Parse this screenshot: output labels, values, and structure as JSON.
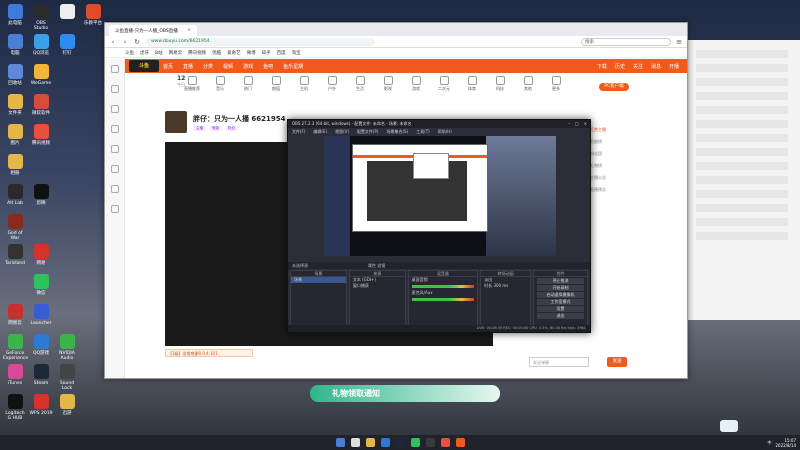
{
  "desktop": {
    "icons": [
      {
        "label": "此电脑",
        "col": 0,
        "row": 0,
        "color": "#3d7bd9"
      },
      {
        "label": "OBS Studio",
        "col": 1,
        "row": 0,
        "color": "#2b2b2b"
      },
      {
        "label": "",
        "col": 2,
        "row": 0,
        "color": "#eeeeee"
      },
      {
        "label": "乐教平台",
        "col": 3,
        "row": 0,
        "color": "#e24b2a"
      },
      {
        "label": "电脑",
        "col": 0,
        "row": 1,
        "color": "#4a7fd6"
      },
      {
        "label": "QQ浏览",
        "col": 1,
        "row": 1,
        "color": "#3aa0e8"
      },
      {
        "label": "钉钉",
        "col": 2,
        "row": 1,
        "color": "#2d8cf0"
      },
      {
        "label": "回收站",
        "col": 0,
        "row": 2,
        "color": "#5d8ad6"
      },
      {
        "label": "WeGame",
        "col": 1,
        "row": 2,
        "color": "#f2b43a"
      },
      {
        "label": "文件夹",
        "col": 0,
        "row": 3,
        "color": "#e5b64a"
      },
      {
        "label": "微软软件",
        "col": 1,
        "row": 3,
        "color": "#d44c3a"
      },
      {
        "label": "图片",
        "col": 0,
        "row": 4,
        "color": "#e5b64a"
      },
      {
        "label": "腾讯视频",
        "col": 1,
        "row": 4,
        "color": "#e84f3d"
      },
      {
        "label": "相册",
        "col": 0,
        "row": 5,
        "color": "#e5b64a"
      },
      {
        "label": "Alt Lab",
        "col": 0,
        "row": 6,
        "color": "#2a2a2a"
      },
      {
        "label": "剪映",
        "col": 1,
        "row": 6,
        "color": "#111111"
      },
      {
        "label": "God of War",
        "col": 0,
        "row": 7,
        "color": "#8a2a1e"
      },
      {
        "label": "Tarisland",
        "col": 0,
        "row": 8,
        "color": "#333333"
      },
      {
        "label": "网易",
        "col": 1,
        "row": 8,
        "color": "#d6322c"
      },
      {
        "label": "微信",
        "col": 1,
        "row": 9,
        "color": "#2ec25b"
      },
      {
        "label": "网易云",
        "col": 0,
        "row": 10,
        "color": "#c3322c"
      },
      {
        "label": "Launcher",
        "col": 1,
        "row": 10,
        "color": "#3a5bd6"
      },
      {
        "label": "GeForce Experience",
        "col": 0,
        "row": 11,
        "color": "#3bb54a"
      },
      {
        "label": "QQ游戏",
        "col": 1,
        "row": 11,
        "color": "#2a7ad6"
      },
      {
        "label": "NVIDIA Audio",
        "col": 2,
        "row": 11,
        "color": "#3bb54a"
      },
      {
        "label": "iTunes",
        "col": 0,
        "row": 12,
        "color": "#d64a9a"
      },
      {
        "label": "Steam",
        "col": 1,
        "row": 12,
        "color": "#1b2838"
      },
      {
        "label": "Sound Lock",
        "col": 2,
        "row": 12,
        "color": "#444444"
      },
      {
        "label": "Logitech G HUB",
        "col": 0,
        "row": 13,
        "color": "#111111"
      },
      {
        "label": "WPS 2019",
        "col": 1,
        "row": 13,
        "color": "#d6322c"
      },
      {
        "label": "迅游",
        "col": 2,
        "row": 13,
        "color": "#e5b64a"
      }
    ]
  },
  "browser": {
    "tab_label": "斗鱼直播-只为一人播_OBS直播",
    "url": "www.douyu.com/6621954",
    "search_placeholder": "搜索",
    "bookmarks": [
      "斗鱼",
      "虎牙",
      "B站",
      "网易云",
      "腾讯视频",
      "优酷",
      "爱奇艺",
      "微博",
      "知乎",
      "百度",
      "淘宝"
    ]
  },
  "site": {
    "logo": "斗鱼",
    "nav": [
      "首页",
      "直播",
      "分类",
      "视频",
      "游戏",
      "鱼吧",
      "鱼乐星期"
    ],
    "nav_right": [
      "下载",
      "历史",
      "关注",
      "消息",
      "开播"
    ],
    "count": "12",
    "count_sub": "今日",
    "categories": [
      "直播推荐",
      "音乐",
      "热门",
      "颜值",
      "主机",
      "户外",
      "生活",
      "影视",
      "游戏",
      "二次元",
      "体育",
      "科技",
      "其他",
      "更多"
    ],
    "pc_button": "PC客户端",
    "streamer_name": "胖仔：只为一人播 6621954",
    "streamer_tags": [
      "主播",
      "等级",
      "粉丝"
    ],
    "chat_placeholder": "发送弹幕",
    "send_label": "发送",
    "gift_banner": "礼物领取通知",
    "dist_mini": "【1级】非常感谢0.0.4.101"
  },
  "rightpanel": {
    "lines": [
      "贡献榜",
      "粉丝团",
      "礼物榜",
      "主播公告",
      "直播预告"
    ],
    "highlight": "打赏主播"
  },
  "obs": {
    "title": "OBS 27.2.3 (64-bit, windows) - 配置文件: 未命名 - 场景: 未命名",
    "menu": [
      "文件(F)",
      "编辑(E)",
      "视图(V)",
      "配置文件(P)",
      "场景集合(S)",
      "工具(T)",
      "帮助(H)"
    ],
    "toolbar_left": "未选择源",
    "toolbar_right": "属性    滤镜",
    "docks": {
      "scenes": {
        "header": "场景",
        "items": [
          "场景"
        ]
      },
      "sources": {
        "header": "来源",
        "items": [
          "文本 (GDI+)",
          "窗口捕获"
        ]
      },
      "mixer": {
        "header": "混音器",
        "items": [
          "桌面音频",
          "麦克风/Aux"
        ]
      },
      "transitions": {
        "header": "转场动画",
        "items": [
          "淡出",
          "时长  300 ms"
        ]
      },
      "controls": {
        "header": "控件",
        "buttons": [
          "停止推流",
          "开始录制",
          "启动虚拟摄像机",
          "工作室模式",
          "设置",
          "退出"
        ]
      }
    },
    "status": "LIVE: 00:28:35   REC: 00:00:00   CPU: 3.3%, 60.00 fps   kb/s: 2981"
  },
  "taskbar": {
    "time": "15:07",
    "date": "2022/8/14",
    "tray_text": "中"
  }
}
